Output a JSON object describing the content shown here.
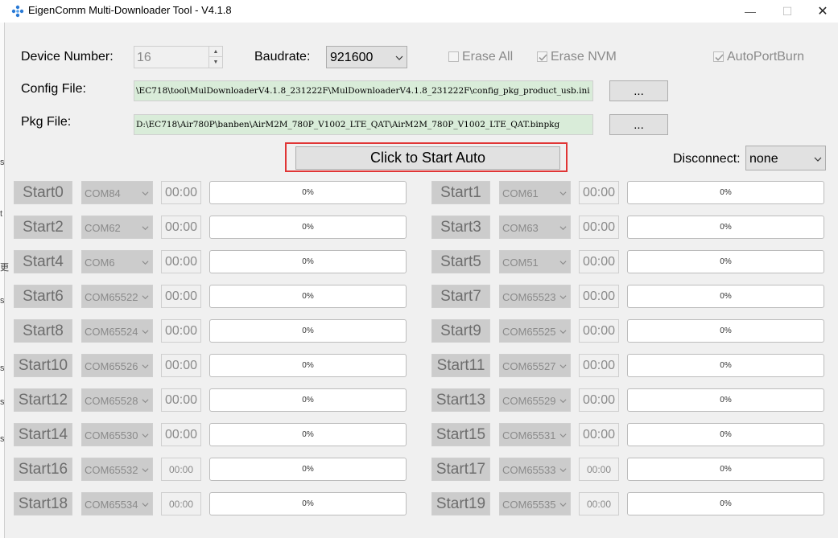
{
  "window": {
    "title": "EigenComm Multi-Downloader Tool - V4.1.8",
    "min_glyph": "—",
    "max_glyph": "☐",
    "close_glyph": "✕",
    "left_edge_glyphs": [
      "s",
      "t",
      "更",
      "s",
      "s",
      "s",
      "s"
    ]
  },
  "settings": {
    "device_number_label": "Device Number:",
    "device_number_value": "16",
    "baudrate_label": "Baudrate:",
    "baudrate_value": "921600",
    "erase_all_label": "Erase All",
    "erase_all_checked": false,
    "erase_nvm_label": "Erase NVM",
    "erase_nvm_checked": true,
    "autoportburn_label": "AutoPortBurn",
    "autoportburn_checked": true,
    "config_file_label": "Config File:",
    "config_file_value": "\\EC718\\tool\\MulDownloaderV4.1.8_231222F\\MulDownloaderV4.1.8_231222F\\config_pkg_product_usb.ini",
    "pkg_file_label": "Pkg File:",
    "pkg_file_value": "D:\\EC718\\Air780P\\banben\\AirM2M_780P_V1002_LTE_QAT\\AirM2M_780P_V1002_LTE_QAT.binpkg",
    "browse_label": "...",
    "start_auto_label": "Click to Start Auto",
    "disconnect_label": "Disconnect:",
    "disconnect_value": "none"
  },
  "devices": [
    {
      "start": "Start0",
      "com": "COM84",
      "time": "00:00",
      "progress": "0%"
    },
    {
      "start": "Start1",
      "com": "COM61",
      "time": "00:00",
      "progress": "0%"
    },
    {
      "start": "Start2",
      "com": "COM62",
      "time": "00:00",
      "progress": "0%"
    },
    {
      "start": "Start3",
      "com": "COM63",
      "time": "00:00",
      "progress": "0%"
    },
    {
      "start": "Start4",
      "com": "COM6",
      "time": "00:00",
      "progress": "0%"
    },
    {
      "start": "Start5",
      "com": "COM51",
      "time": "00:00",
      "progress": "0%"
    },
    {
      "start": "Start6",
      "com": "COM65522",
      "time": "00:00",
      "progress": "0%"
    },
    {
      "start": "Start7",
      "com": "COM65523",
      "time": "00:00",
      "progress": "0%"
    },
    {
      "start": "Start8",
      "com": "COM65524",
      "time": "00:00",
      "progress": "0%"
    },
    {
      "start": "Start9",
      "com": "COM65525",
      "time": "00:00",
      "progress": "0%"
    },
    {
      "start": "Start10",
      "com": "COM65526",
      "time": "00:00",
      "progress": "0%"
    },
    {
      "start": "Start11",
      "com": "COM65527",
      "time": "00:00",
      "progress": "0%"
    },
    {
      "start": "Start12",
      "com": "COM65528",
      "time": "00:00",
      "progress": "0%"
    },
    {
      "start": "Start13",
      "com": "COM65529",
      "time": "00:00",
      "progress": "0%"
    },
    {
      "start": "Start14",
      "com": "COM65530",
      "time": "00:00",
      "progress": "0%"
    },
    {
      "start": "Start15",
      "com": "COM65531",
      "time": "00:00",
      "progress": "0%"
    },
    {
      "start": "Start16",
      "com": "COM65532",
      "time": "00:00",
      "progress": "0%"
    },
    {
      "start": "Start17",
      "com": "COM65533",
      "time": "00:00",
      "progress": "0%"
    },
    {
      "start": "Start18",
      "com": "COM65534",
      "time": "00:00",
      "progress": "0%"
    },
    {
      "start": "Start19",
      "com": "COM65535",
      "time": "00:00",
      "progress": "0%"
    }
  ]
}
